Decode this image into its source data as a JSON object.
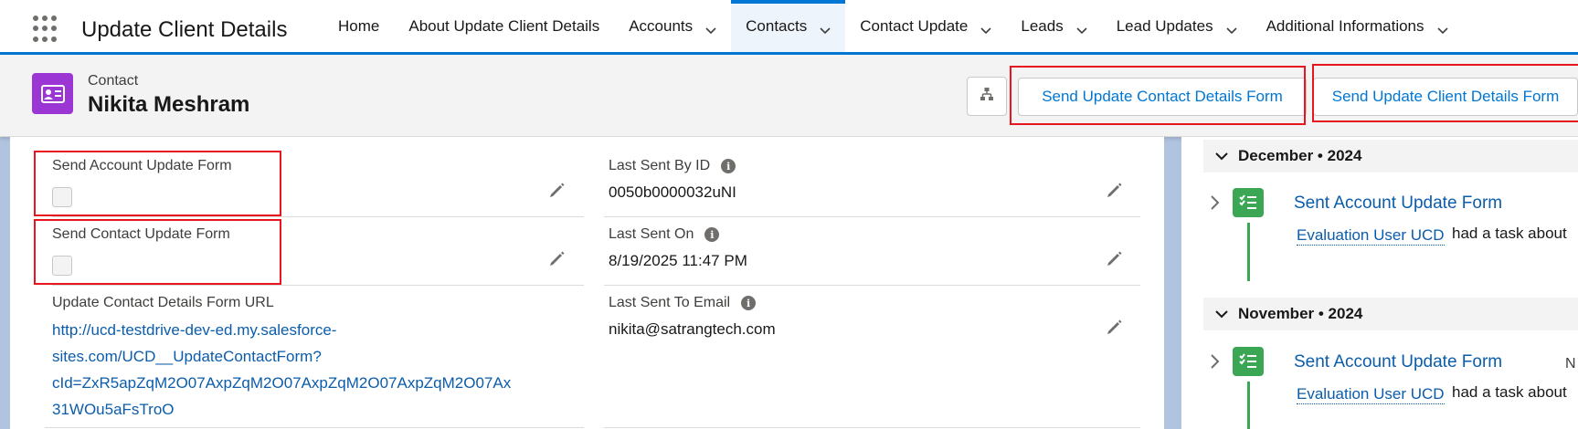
{
  "app": {
    "name": "Update Client Details"
  },
  "nav": {
    "items": [
      {
        "label": "Home",
        "dropdown": false,
        "active": false
      },
      {
        "label": "About Update Client Details",
        "dropdown": false,
        "active": false
      },
      {
        "label": "Accounts",
        "dropdown": true,
        "active": false
      },
      {
        "label": "Contacts",
        "dropdown": true,
        "active": true
      },
      {
        "label": "Contact Update",
        "dropdown": true,
        "active": false
      },
      {
        "label": "Leads",
        "dropdown": true,
        "active": false
      },
      {
        "label": "Lead Updates",
        "dropdown": true,
        "active": false
      },
      {
        "label": "Additional Informations",
        "dropdown": true,
        "active": false
      }
    ]
  },
  "record": {
    "entity": "Contact",
    "name": "Nikita Meshram",
    "actions": {
      "send_contact_form": "Send Update Contact Details Form",
      "send_client_form": "Send Update Client Details Form"
    }
  },
  "details": {
    "send_account_update_form": {
      "label": "Send Account Update Form",
      "checked": false
    },
    "send_contact_update_form": {
      "label": "Send Contact Update Form",
      "checked": false
    },
    "form_url": {
      "label": "Update Contact Details Form URL",
      "lines": [
        "http://ucd-testdrive-dev-ed.my.salesforce-",
        "sites.com/UCD__UpdateContactForm?",
        "cId=ZxR5apZqM2O07AxpZqM2O07AxpZqM2O07AxpZqM2O07Ax",
        "31WOu5aFsTroO"
      ]
    },
    "last_sent_by_id": {
      "label": "Last Sent By ID",
      "value": "0050b0000032uNI"
    },
    "last_sent_on": {
      "label": "Last Sent On",
      "value": "8/19/2025 11:47 PM"
    },
    "last_sent_to_email": {
      "label": "Last Sent To Email",
      "value": "nikita@satrangtech.com"
    }
  },
  "activity": {
    "groups": [
      {
        "header": "December • 2024",
        "task": {
          "title": "Sent Account Update Form",
          "user": "Evaluation User UCD",
          "text": "had a task about"
        }
      },
      {
        "header": "November • 2024",
        "task": {
          "title": "Sent Account Update Form",
          "user": "Evaluation User UCD",
          "text": "had a task about",
          "trailing": "N"
        }
      }
    ]
  },
  "colors": {
    "brand": "#0176d3",
    "highlight": "#e8141e",
    "task": "#3ba755",
    "contact_icon": "#9b36d4"
  }
}
